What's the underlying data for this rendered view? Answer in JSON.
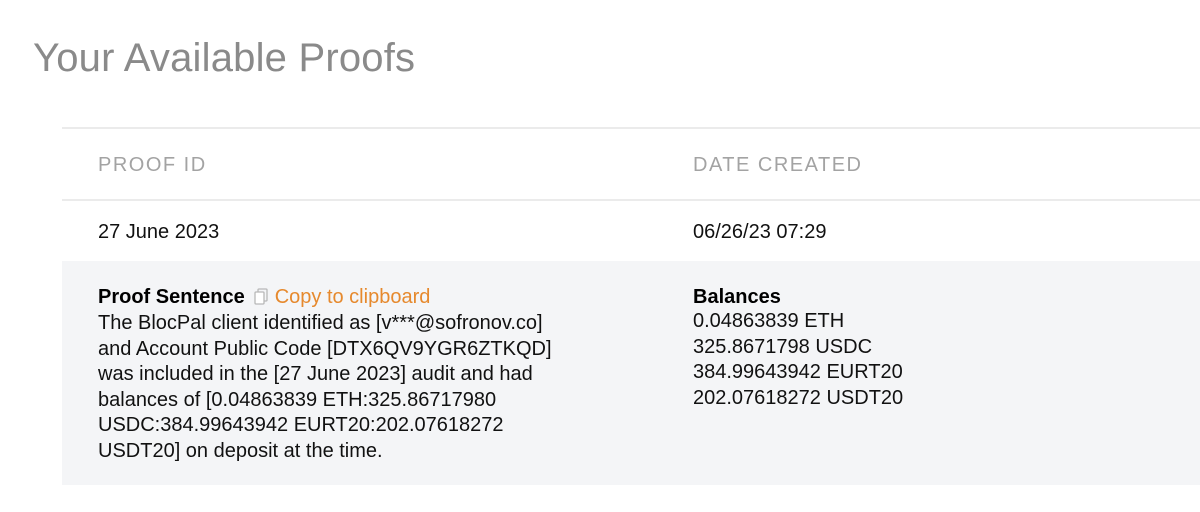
{
  "page": {
    "title": "Your Available Proofs"
  },
  "table": {
    "headers": {
      "proof_id": "PROOF ID",
      "date_created": "DATE CREATED"
    },
    "rows": [
      {
        "proof_id": "27 June 2023",
        "date_created": "06/26/23 07:29"
      }
    ]
  },
  "detail": {
    "proof_sentence_label": "Proof Sentence",
    "copy_label": "Copy to clipboard",
    "copy_icon": "copy-icon",
    "sentence_lines": [
      "The BlocPal client identified as [v***@sofronov.co]",
      "and Account Public Code [DTX6QV9YGR6ZTKQD]",
      "was included in the [27 June 2023] audit and had",
      "balances of [0.04863839 ETH:325.86717980",
      "USDC:384.99643942 EURT20:202.07618272",
      "USDT20] on deposit at the time."
    ],
    "balances_label": "Balances",
    "balances": [
      "0.04863839 ETH",
      "325.8671798 USDC",
      "384.99643942 EURT20",
      "202.07618272 USDT20"
    ]
  },
  "colors": {
    "title": "#8a8a8a",
    "header_text": "#a3a3a3",
    "accent_link": "#e6892d",
    "detail_background": "#f4f5f7",
    "divider": "#ebebeb"
  }
}
